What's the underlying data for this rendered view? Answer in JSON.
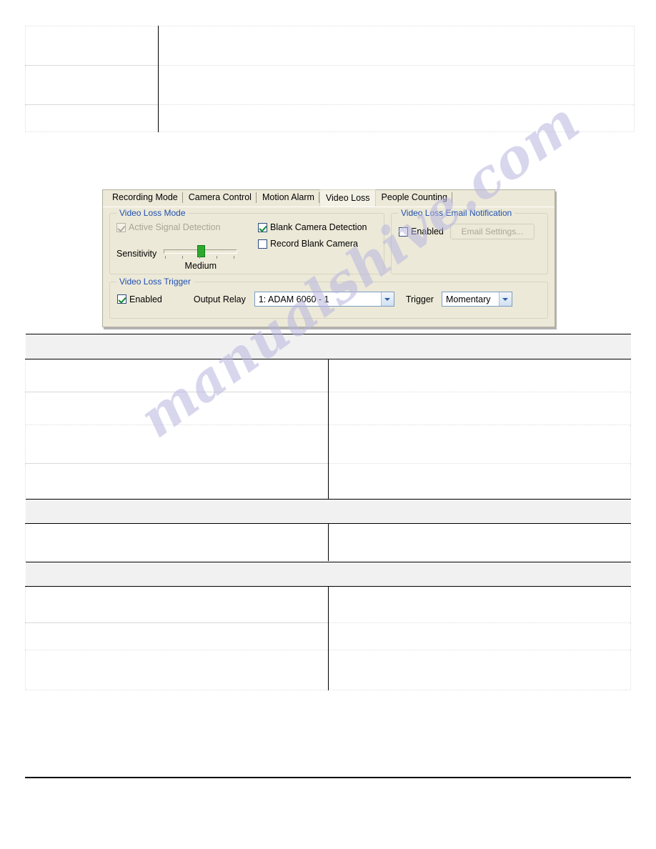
{
  "document": {
    "tables": [
      {
        "name": "upper-table",
        "rows": [
          {
            "cells": [
              "",
              ""
            ]
          },
          {
            "cells": [
              "",
              ""
            ]
          },
          {
            "cells": [
              "",
              ""
            ]
          }
        ]
      },
      {
        "name": "middle-table",
        "header_band": "",
        "rows": [
          {
            "cells": [
              "",
              ""
            ]
          },
          {
            "cells": [
              "",
              ""
            ]
          },
          {
            "cells": [
              "",
              ""
            ]
          },
          {
            "cells": [
              "",
              ""
            ]
          }
        ]
      },
      {
        "name": "lower-table-a",
        "header_band": "",
        "rows": [
          {
            "cells": [
              "",
              ""
            ]
          }
        ]
      },
      {
        "name": "lower-table-b",
        "header_band": "",
        "rows": [
          {
            "cells": [
              "",
              ""
            ]
          },
          {
            "cells": [
              "",
              ""
            ]
          },
          {
            "cells": [
              "",
              ""
            ]
          }
        ]
      }
    ]
  },
  "watermark": {
    "text": "manualshive.com"
  },
  "dialog": {
    "tabs": [
      {
        "label": "Recording Mode",
        "selected": false
      },
      {
        "label": "Camera Control",
        "selected": false
      },
      {
        "label": "Motion Alarm",
        "selected": false
      },
      {
        "label": "Video Loss",
        "selected": true
      },
      {
        "label": "People Counting",
        "selected": false
      }
    ],
    "video_loss_mode": {
      "title": "Video Loss Mode",
      "active_signal_detection": {
        "label": "Active Signal Detection",
        "checked": true,
        "enabled": false
      },
      "blank_camera_detection": {
        "label": "Blank Camera Detection",
        "checked": true,
        "enabled": true
      },
      "record_blank_camera": {
        "label": "Record Blank Camera",
        "checked": false,
        "enabled": true
      },
      "sensitivity": {
        "label": "Sensitivity",
        "value": "Medium",
        "position_percent": 50,
        "tick_count": 5
      }
    },
    "email_notification": {
      "title": "Video Loss Email Notification",
      "enabled": {
        "label": "Enabled",
        "checked": false
      },
      "settings_button": {
        "label": "Email Settings...",
        "enabled": false
      }
    },
    "video_loss_trigger": {
      "title": "Video Loss Trigger",
      "enabled": {
        "label": "Enabled",
        "checked": true
      },
      "output_relay": {
        "label": "Output Relay",
        "value": "1: ADAM 6060 - 1"
      },
      "trigger": {
        "label": "Trigger",
        "value": "Momentary"
      }
    }
  },
  "colors": {
    "dialog_background": "#ECE9D8",
    "group_title": "#1F4FB0",
    "check_green": "#128A2D",
    "checkbox_border": "#2C4A7C",
    "slider_thumb": "#2FA82F",
    "combo_border": "#7D9BBF",
    "disabled_text": "#A7A593",
    "watermark": "#B9B6E0"
  }
}
